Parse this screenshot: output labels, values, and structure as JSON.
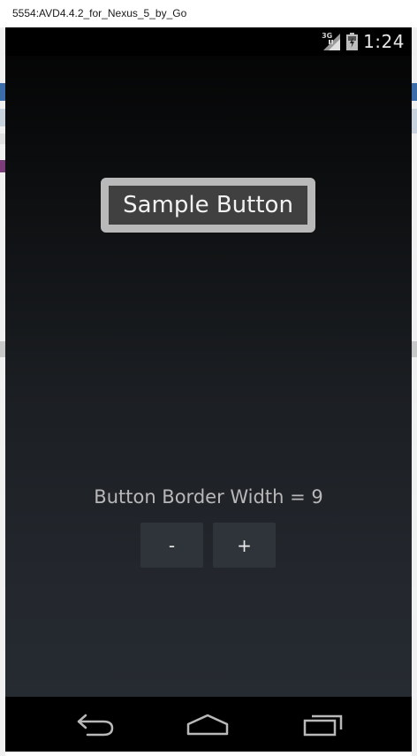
{
  "window": {
    "title": "5554:AVD4.4.2_for_Nexus_5_by_Go"
  },
  "status_bar": {
    "network_label": "3G",
    "network_icon": "signal-icon",
    "battery_icon": "battery-icon",
    "time": "1:24"
  },
  "main": {
    "sample_button_label": "Sample Button",
    "border_width_label": "Button Border Width = 9",
    "decrement_label": "-",
    "increment_label": "+"
  },
  "nav_bar": {
    "back_icon": "back-icon",
    "home_icon": "home-icon",
    "recents_icon": "recent-apps-icon"
  },
  "colors": {
    "button_border": "#b9b9b9",
    "button_face": "#404040",
    "background_top": "#030303",
    "background_bottom": "#272b33"
  }
}
